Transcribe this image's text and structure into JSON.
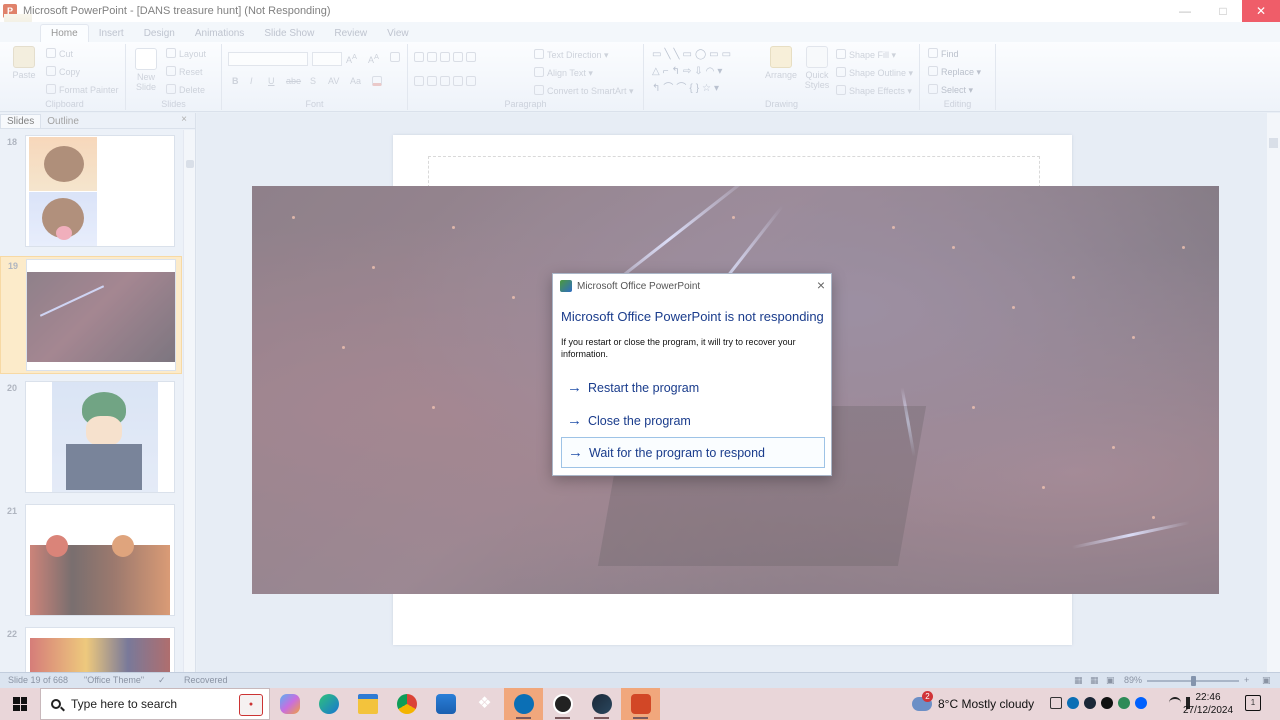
{
  "window": {
    "title": "Microsoft PowerPoint - [DANS treasure hunt] (Not Responding)",
    "app_icon": "powerpoint-icon",
    "controls": [
      "minimize-icon",
      "maximize-icon",
      "close-icon"
    ]
  },
  "ribbon": {
    "tabs": [
      {
        "label": "Home",
        "active": true
      },
      {
        "label": "Insert",
        "active": false
      },
      {
        "label": "Design",
        "active": false
      },
      {
        "label": "Animations",
        "active": false
      },
      {
        "label": "Slide Show",
        "active": false
      },
      {
        "label": "Review",
        "active": false
      },
      {
        "label": "View",
        "active": false
      }
    ],
    "clipboard": {
      "label": "Clipboard",
      "paste": "Paste",
      "cut": "Cut",
      "copy": "Copy",
      "format_painter": "Format Painter"
    },
    "slides": {
      "label": "Slides",
      "new_slide": "New Slide",
      "layout": "Layout",
      "reset": "Reset",
      "delete": "Delete"
    },
    "font": {
      "label": "Font",
      "bold": "B",
      "italic": "I",
      "underline": "U",
      "strike": "abe",
      "shadow": "S",
      "spacing": "AV",
      "case": "Aa"
    },
    "paragraph": {
      "label": "Paragraph",
      "text_direction": "Text Direction",
      "align_text": "Align Text",
      "smartart": "Convert to SmartArt"
    },
    "drawing": {
      "label": "Drawing",
      "arrange": "Arrange",
      "quick_styles": "Quick Styles",
      "shape_fill": "Shape Fill",
      "shape_outline": "Shape Outline",
      "shape_effects": "Shape Effects"
    },
    "editing": {
      "label": "Editing",
      "find": "Find",
      "replace": "Replace",
      "select": "Select"
    }
  },
  "slides_panel": {
    "tabs": [
      {
        "label": "Slides",
        "active": true
      },
      {
        "label": "Outline",
        "active": false
      }
    ],
    "close": "×",
    "slides": [
      {
        "number": "18",
        "selected": false
      },
      {
        "number": "19",
        "selected": true
      },
      {
        "number": "20",
        "selected": false
      },
      {
        "number": "21",
        "selected": false
      },
      {
        "number": "22",
        "selected": false
      }
    ]
  },
  "dialog": {
    "window_title": "Microsoft Office PowerPoint",
    "heading": "Microsoft Office PowerPoint is not responding",
    "message": "If you restart or close the program, it will try to recover your information.",
    "options": [
      {
        "label": "Restart the program",
        "focused": false
      },
      {
        "label": "Close the program",
        "focused": false
      },
      {
        "label": "Wait for the program to respond",
        "focused": true
      }
    ],
    "close": "×"
  },
  "status_bar": {
    "slide_position": "Slide 19 of 668",
    "theme": "\"Office Theme\"",
    "recovered": "Recovered",
    "zoom": "89%",
    "zoom_level": 0.5
  },
  "taskbar": {
    "search_placeholder": "Type here to search",
    "apps": [
      "copilot-icon",
      "edge-icon",
      "file-explorer-icon",
      "chrome-icon",
      "store-icon",
      "dropbox-icon",
      "vlc-icon",
      "steam-like-icon",
      "steam-icon",
      "powerpoint-icon"
    ],
    "weather": {
      "badge": "2",
      "text": "8°C  Mostly cloudy"
    },
    "time": "22:46",
    "date": "27/12/2024",
    "notification_badge": "1"
  },
  "colors": {
    "dialog_heading": "#1a3c8c",
    "close_button": "#e81123",
    "taskbar": "#e9d6d9",
    "active_taskbar_app": "#f1a77c"
  }
}
